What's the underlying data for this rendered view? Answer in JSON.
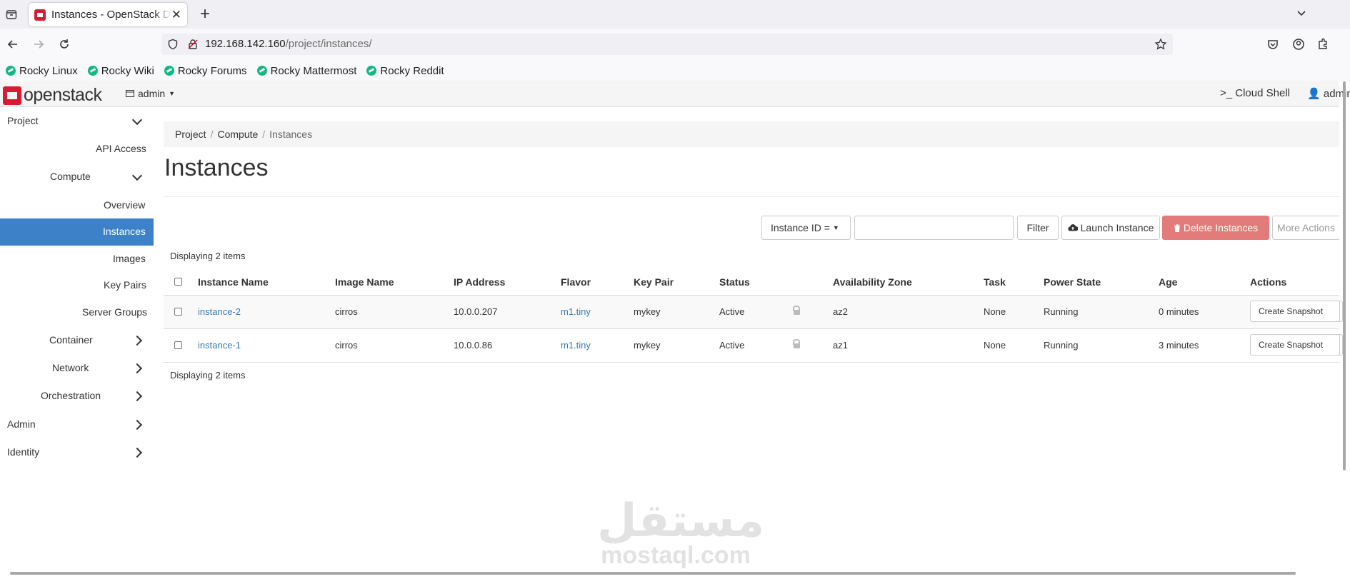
{
  "browser": {
    "tab_title": "Instances - OpenStack Dashboard",
    "tab_close": "✕",
    "new_tab": "+",
    "url_host": "192.168.142.160",
    "url_path": "/project/instances/",
    "bookmarks": [
      {
        "label": "Rocky Linux"
      },
      {
        "label": "Rocky Wiki"
      },
      {
        "label": "Rocky Forums"
      },
      {
        "label": "Rocky Mattermost"
      },
      {
        "label": "Rocky Reddit"
      }
    ]
  },
  "header": {
    "logo": "openstack",
    "project_dropdown": "admin",
    "cloud_shell": ">_ Cloud Shell",
    "user_menu": "admin"
  },
  "sidebar": {
    "project": "Project",
    "api_access": "API Access",
    "compute": "Compute",
    "overview": "Overview",
    "instances": "Instances",
    "images": "Images",
    "key_pairs": "Key Pairs",
    "server_groups": "Server Groups",
    "container": "Container",
    "network": "Network",
    "orchestration": "Orchestration",
    "admin": "Admin",
    "identity": "Identity"
  },
  "breadcrumb": [
    "Project",
    "Compute",
    "Instances"
  ],
  "page_title": "Instances",
  "toolbar": {
    "filter_select": "Instance ID =",
    "filter_value": "",
    "filter_button": "Filter",
    "launch_button": "Launch Instance",
    "delete_button": "Delete Instances",
    "more_button": "More Actions"
  },
  "table": {
    "count_top": "Displaying 2 items",
    "count_bottom": "Displaying 2 items",
    "headers": [
      "Instance Name",
      "Image Name",
      "IP Address",
      "Flavor",
      "Key Pair",
      "Status",
      "Availability Zone",
      "Task",
      "Power State",
      "Age",
      "Actions"
    ],
    "rows": [
      {
        "name": "instance-2",
        "image": "cirros",
        "ip": "10.0.0.207",
        "flavor": "m1.tiny",
        "key_pair": "mykey",
        "status": "Active",
        "az": "az2",
        "task": "None",
        "power": "Running",
        "age": "0 minutes",
        "action": "Create Snapshot"
      },
      {
        "name": "instance-1",
        "image": "cirros",
        "ip": "10.0.0.86",
        "flavor": "m1.tiny",
        "key_pair": "mykey",
        "status": "Active",
        "az": "az1",
        "task": "None",
        "power": "Running",
        "age": "3 minutes",
        "action": "Create Snapshot"
      }
    ]
  },
  "watermark": {
    "arabic": "مستقل",
    "latin": "mostaql.com"
  },
  "colors": {
    "accent": "#3d82c9",
    "brand": "#da1a32",
    "danger": "#e27b79",
    "link": "#337ab7"
  }
}
